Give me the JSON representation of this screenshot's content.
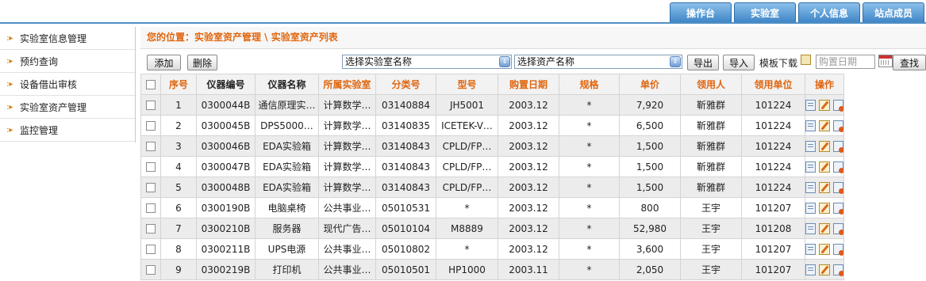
{
  "top_tabs": [
    "操作台",
    "实验室",
    "个人信息",
    "站点成员"
  ],
  "sidebar": {
    "items": [
      {
        "label": "实验室信息管理"
      },
      {
        "label": "预约查询"
      },
      {
        "label": "设备借出审核"
      },
      {
        "label": "实验室资产管理"
      },
      {
        "label": "监控管理"
      }
    ]
  },
  "breadcrumb": "您的位置：实验室资产管理 \\ 实验室资产列表",
  "toolbar": {
    "add_label": "添加",
    "delete_label": "删除",
    "lab_select": "选择实验室名称",
    "asset_select": "选择资产名称",
    "export_label": "导出",
    "import_label": "导入",
    "template_label": "模板下载",
    "date_placeholder": "购置日期",
    "search_label": "查找"
  },
  "table": {
    "headers": [
      "序号",
      "仪器编号",
      "仪器名称",
      "所属实验室",
      "分类号",
      "型号",
      "购置日期",
      "规格",
      "单价",
      "领用人",
      "领用单位",
      "操作"
    ],
    "rows": [
      {
        "no": "1",
        "code": "0300044B",
        "name": "通信原理实…",
        "lab": "计算数学…",
        "class": "03140884",
        "model": "JH5001",
        "date": "2003.12",
        "spec": "*",
        "price": "7,920",
        "user": "靳雅群",
        "unit": "101224"
      },
      {
        "no": "2",
        "code": "0300045B",
        "name": "DPS5000…",
        "lab": "计算数学…",
        "class": "03140835",
        "model": "ICETEK-V…",
        "date": "2003.12",
        "spec": "*",
        "price": "6,500",
        "user": "靳雅群",
        "unit": "101224"
      },
      {
        "no": "3",
        "code": "0300046B",
        "name": "EDA实验箱",
        "lab": "计算数学…",
        "class": "03140843",
        "model": "CPLD/FP…",
        "date": "2003.12",
        "spec": "*",
        "price": "1,500",
        "user": "靳雅群",
        "unit": "101224"
      },
      {
        "no": "4",
        "code": "0300047B",
        "name": "EDA实验箱",
        "lab": "计算数学…",
        "class": "03140843",
        "model": "CPLD/FP…",
        "date": "2003.12",
        "spec": "*",
        "price": "1,500",
        "user": "靳雅群",
        "unit": "101224"
      },
      {
        "no": "5",
        "code": "0300048B",
        "name": "EDA实验箱",
        "lab": "计算数学…",
        "class": "03140843",
        "model": "CPLD/FP…",
        "date": "2003.12",
        "spec": "*",
        "price": "1,500",
        "user": "靳雅群",
        "unit": "101224"
      },
      {
        "no": "6",
        "code": "0300190B",
        "name": "电脑桌椅",
        "lab": "公共事业…",
        "class": "05010531",
        "model": "*",
        "date": "2003.12",
        "spec": "*",
        "price": "800",
        "user": "王宇",
        "unit": "101207"
      },
      {
        "no": "7",
        "code": "0300210B",
        "name": "服务器",
        "lab": "现代广告…",
        "class": "05010104",
        "model": "M8889",
        "date": "2003.12",
        "spec": "*",
        "price": "52,980",
        "user": "王宇",
        "unit": "101208"
      },
      {
        "no": "8",
        "code": "0300211B",
        "name": "UPS电源",
        "lab": "公共事业…",
        "class": "05010802",
        "model": "*",
        "date": "2003.12",
        "spec": "*",
        "price": "3,600",
        "user": "王宇",
        "unit": "101207"
      },
      {
        "no": "9",
        "code": "0300219B",
        "name": "打印机",
        "lab": "公共事业…",
        "class": "05010501",
        "model": "HP1000",
        "date": "2003.11",
        "spec": "*",
        "price": "2,050",
        "user": "王宇",
        "unit": "101207"
      }
    ]
  }
}
